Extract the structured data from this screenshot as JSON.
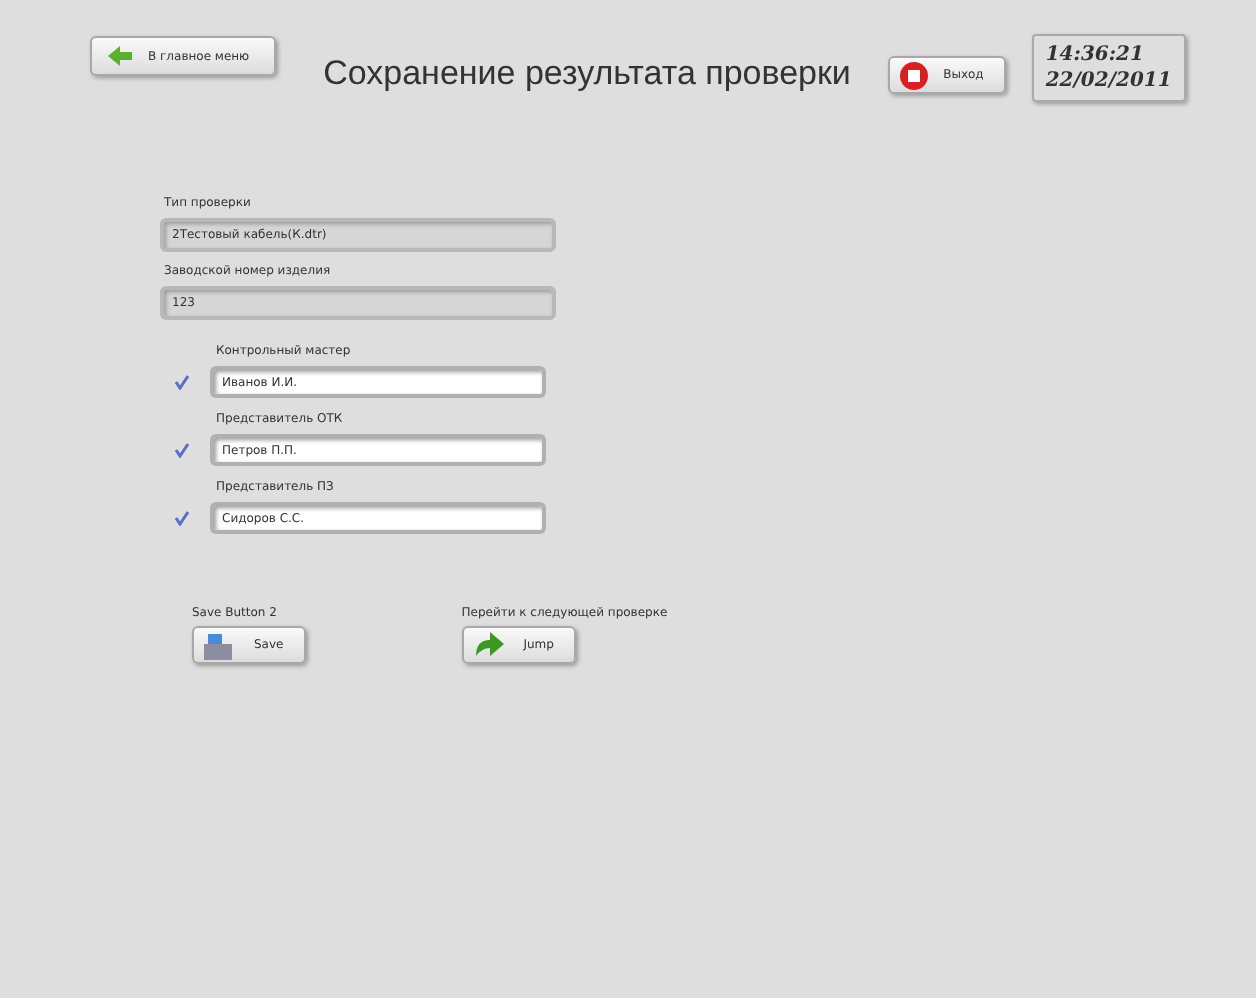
{
  "header": {
    "back_button": "В главное меню",
    "title": "Сохранение результата проверки",
    "exit_button": "Выход",
    "time": "14:36:21",
    "date": "22/02/2011"
  },
  "readonly_fields": [
    {
      "label": "Тип проверки",
      "value": "2Тестовый кабель(К.dtr)"
    },
    {
      "label": "Заводской номер изделия",
      "value": "123"
    }
  ],
  "signers": [
    {
      "label": "Контрольный мастер",
      "value": "Иванов И.И.",
      "checked": true
    },
    {
      "label": "Представитель ОТК",
      "value": "Петров П.П.",
      "checked": true
    },
    {
      "label": "Представитель ПЗ",
      "value": "Сидоров С.С.",
      "checked": true
    }
  ],
  "actions": [
    {
      "kind": "save",
      "label": "Save Button 2",
      "button": "Save"
    },
    {
      "kind": "jump",
      "label": "Перейти к следующей проверке",
      "button": "Jump"
    }
  ]
}
